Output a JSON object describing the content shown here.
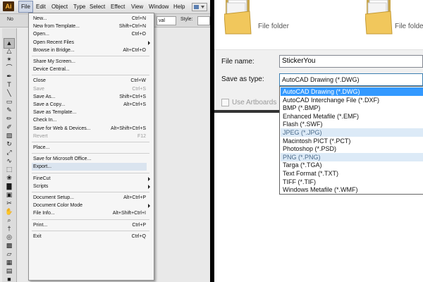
{
  "illustrator": {
    "app_icon": "Ai",
    "menubar": [
      "File",
      "Edit",
      "Object",
      "Type",
      "Select",
      "Effect",
      "View",
      "Window",
      "Help"
    ],
    "control_bar": {
      "left_text": "No",
      "fields": [
        "",
        "val"
      ],
      "style_label": "Style:"
    },
    "tools": [
      "selection-arrow",
      "direct-select",
      "magic-wand",
      "lasso",
      "pen",
      "type",
      "line",
      "rectangle",
      "paintbrush",
      "pencil",
      "blob-brush",
      "eraser",
      "rotate",
      "scale",
      "warp",
      "free-transform",
      "symbol-sprayer",
      "graph",
      "artboard",
      "slice",
      "hand",
      "zoom",
      "eyedropper",
      "blend",
      "live-paint",
      "perspective",
      "mesh",
      "gradient",
      "fill-stroke"
    ],
    "file_menu": {
      "items": [
        {
          "label": "New...",
          "shortcut": "Ctrl+N"
        },
        {
          "label": "New from Template...",
          "shortcut": "Shift+Ctrl+N"
        },
        {
          "label": "Open...",
          "shortcut": "Ctrl+O"
        },
        {
          "label": "Open Recent Files",
          "shortcut": "",
          "submenu": true
        },
        {
          "label": "Browse in Bridge...",
          "shortcut": "Alt+Ctrl+O"
        },
        {
          "sep": true
        },
        {
          "label": "Share My Screen...",
          "shortcut": ""
        },
        {
          "label": "Device Central...",
          "shortcut": ""
        },
        {
          "sep": true
        },
        {
          "label": "Close",
          "shortcut": "Ctrl+W"
        },
        {
          "label": "Save",
          "shortcut": "Ctrl+S",
          "disabled": true
        },
        {
          "label": "Save As...",
          "shortcut": "Shift+Ctrl+S"
        },
        {
          "label": "Save a Copy...",
          "shortcut": "Alt+Ctrl+S"
        },
        {
          "label": "Save as Template...",
          "shortcut": ""
        },
        {
          "label": "Check In...",
          "shortcut": ""
        },
        {
          "label": "Save for Web & Devices...",
          "shortcut": "Alt+Shift+Ctrl+S"
        },
        {
          "label": "Revert",
          "shortcut": "F12",
          "disabled": true
        },
        {
          "sep": true
        },
        {
          "label": "Place...",
          "shortcut": ""
        },
        {
          "sep": true
        },
        {
          "label": "Save for Microsoft Office...",
          "shortcut": ""
        },
        {
          "label": "Export...",
          "shortcut": "",
          "highlighted": true
        },
        {
          "sep": true
        },
        {
          "label": "FineCut",
          "shortcut": "",
          "submenu": true
        },
        {
          "label": "Scripts",
          "shortcut": "",
          "submenu": true
        },
        {
          "sep": true
        },
        {
          "label": "Document Setup...",
          "shortcut": "Alt+Ctrl+P"
        },
        {
          "label": "Document Color Mode",
          "shortcut": "",
          "submenu": true
        },
        {
          "label": "File Info...",
          "shortcut": "Alt+Shift+Ctrl+I"
        },
        {
          "sep": true
        },
        {
          "label": "Print...",
          "shortcut": "Ctrl+P"
        },
        {
          "sep": true
        },
        {
          "label": "Exit",
          "shortcut": "Ctrl+Q"
        }
      ]
    }
  },
  "save_dialog": {
    "folders": [
      {
        "label": "File folder"
      },
      {
        "label": "File folder"
      }
    ],
    "file_name_label": "File name:",
    "file_name_value": "StickerYou",
    "save_as_type_label": "Save as type:",
    "save_as_type_value": "AutoCAD Drawing (*.DWG)",
    "use_artboards_label": "Use Artboards",
    "type_options": [
      {
        "label": "AutoCAD Drawing (*.DWG)",
        "state": "selected"
      },
      {
        "label": "AutoCAD Interchange File (*.DXF)",
        "state": ""
      },
      {
        "label": "BMP (*.BMP)",
        "state": ""
      },
      {
        "label": "Enhanced Metafile (*.EMF)",
        "state": ""
      },
      {
        "label": "Flash (*.SWF)",
        "state": ""
      },
      {
        "label": "JPEG (*.JPG)",
        "state": "hover"
      },
      {
        "label": "Macintosh PICT (*.PCT)",
        "state": ""
      },
      {
        "label": "Photoshop (*.PSD)",
        "state": ""
      },
      {
        "label": "PNG (*.PNG)",
        "state": "hover"
      },
      {
        "label": "Targa (*.TGA)",
        "state": ""
      },
      {
        "label": "Text Format (*.TXT)",
        "state": ""
      },
      {
        "label": "TIFF (*.TIF)",
        "state": ""
      },
      {
        "label": "Windows Metafile (*.WMF)",
        "state": ""
      }
    ]
  },
  "colors": {
    "selection_blue": "#3399ff",
    "hover_blue": "#dceaf7",
    "menu_highlight": "#dae4ef",
    "ai_logo_bg": "#4a2a06",
    "ai_logo_fg": "#ffb63a"
  }
}
